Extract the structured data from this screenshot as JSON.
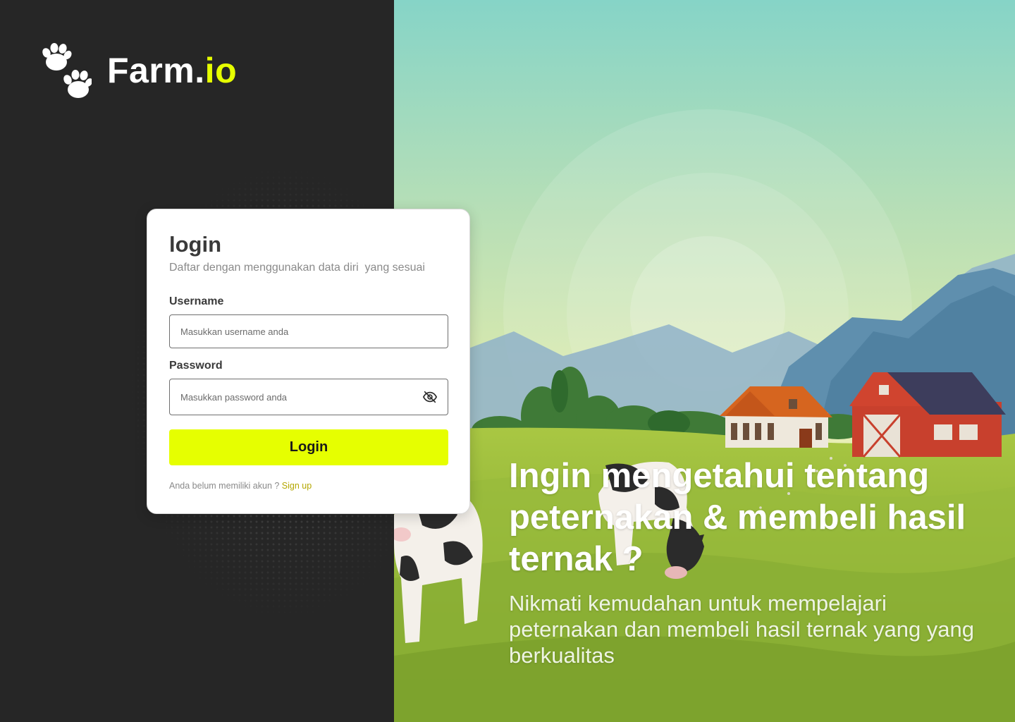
{
  "brand": {
    "name": "Farm.",
    "suffix": "io",
    "accent_color": "#e6ff00",
    "icon": "paw-icon"
  },
  "login": {
    "title": "login",
    "subtitle": "Daftar dengan menggunakan data diri  yang sesuai",
    "username_label": "Username",
    "username_placeholder": "Masukkan username anda",
    "password_label": "Password",
    "password_placeholder": "Masukkan password anda",
    "password_toggle_icon": "eye-off-icon",
    "submit_label": "Login",
    "signup_prompt": "Anda belum memiliki akun ? ",
    "signup_link": "Sign up"
  },
  "hero": {
    "title": "Ingin mengetahui tentang peternakan & membeli hasil ternak ?",
    "subtitle": "Nikmati kemudahan untuk mempelajari peternakan dan membeli hasil ternak yang yang berkualitas"
  },
  "colors": {
    "left_background": "#262626",
    "button_background": "#e6ff00",
    "link_color": "#b4a700"
  }
}
